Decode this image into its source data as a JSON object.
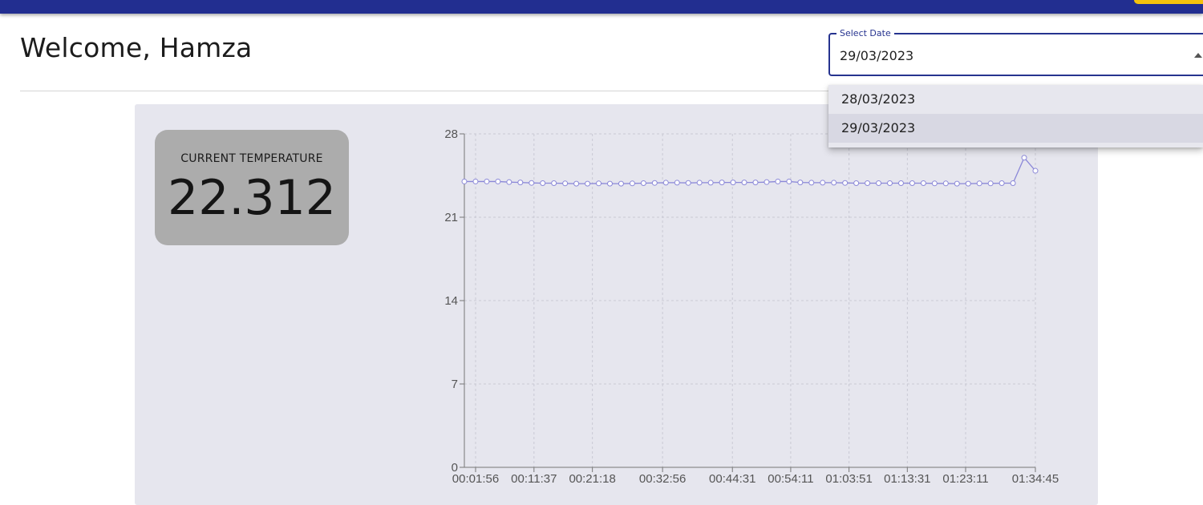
{
  "header": {
    "welcome": "Welcome, Hamza"
  },
  "date_select": {
    "label": "Select Date",
    "value": "29/03/2023",
    "options": [
      "28/03/2023",
      "29/03/2023"
    ],
    "highlighted_option": "29/03/2023"
  },
  "current_temperature": {
    "label": "CURRENT TEMPERATURE",
    "value": "22.312"
  },
  "colors": {
    "topbar": "#222e90",
    "accent": "#f4c20d",
    "line": "#8b88d8",
    "panel": "#e6e6ee",
    "card": "#acacac"
  },
  "chart_data": {
    "type": "line",
    "title": "",
    "xlabel": "",
    "ylabel": "",
    "ylim": [
      0,
      28
    ],
    "yticks": [
      0,
      7,
      14,
      21,
      28
    ],
    "xticks": [
      "00:01:56",
      "00:11:37",
      "00:21:18",
      "00:32:56",
      "00:44:31",
      "00:54:11",
      "01:03:51",
      "01:13:31",
      "01:23:11",
      "01:34:45"
    ],
    "grid": true,
    "series": [
      {
        "values": [
          24.0,
          24.0,
          24.0,
          24.0,
          23.95,
          23.92,
          23.88,
          23.86,
          23.86,
          23.84,
          23.82,
          23.82,
          23.84,
          23.82,
          23.82,
          23.84,
          23.86,
          23.88,
          23.9,
          23.9,
          23.88,
          23.9,
          23.9,
          23.92,
          23.92,
          23.92,
          23.92,
          23.95,
          24.0,
          24.0,
          23.92,
          23.9,
          23.9,
          23.9,
          23.88,
          23.86,
          23.86,
          23.86,
          23.86,
          23.86,
          23.86,
          23.86,
          23.84,
          23.84,
          23.82,
          23.82,
          23.84,
          23.84,
          23.86,
          23.86,
          26.0,
          24.9
        ]
      }
    ]
  }
}
